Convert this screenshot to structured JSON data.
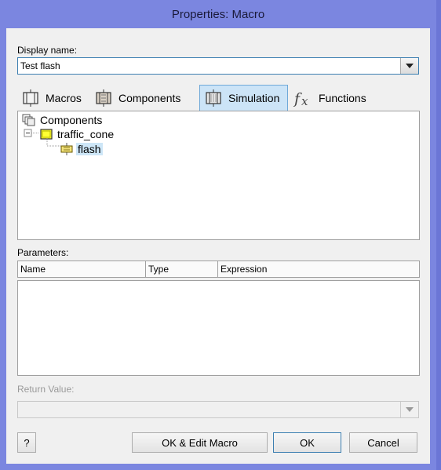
{
  "window": {
    "title": "Properties: Macro"
  },
  "display_name": {
    "label": "Display name:",
    "value": "Test flash"
  },
  "tabs": [
    {
      "label": "Macros",
      "icon": "macro-icon",
      "active": false
    },
    {
      "label": "Components",
      "icon": "component-icon",
      "active": false
    },
    {
      "label": "Simulation",
      "icon": "simulation-icon",
      "active": true
    },
    {
      "label": "Functions",
      "icon": "fx-icon",
      "active": false
    }
  ],
  "tree": {
    "root": "Components",
    "child": "traffic_cone",
    "leaf": "flash"
  },
  "parameters": {
    "label": "Parameters:",
    "columns": [
      "Name",
      "Type",
      "Expression"
    ],
    "rows": []
  },
  "return_value": {
    "label": "Return Value:",
    "value": ""
  },
  "buttons": {
    "help": "?",
    "ok_edit": "OK & Edit Macro",
    "ok": "OK",
    "cancel": "Cancel"
  },
  "colors": {
    "titlebar": "#7b86e0",
    "selection": "#cde6f7",
    "focus_border": "#3c7fb1"
  }
}
